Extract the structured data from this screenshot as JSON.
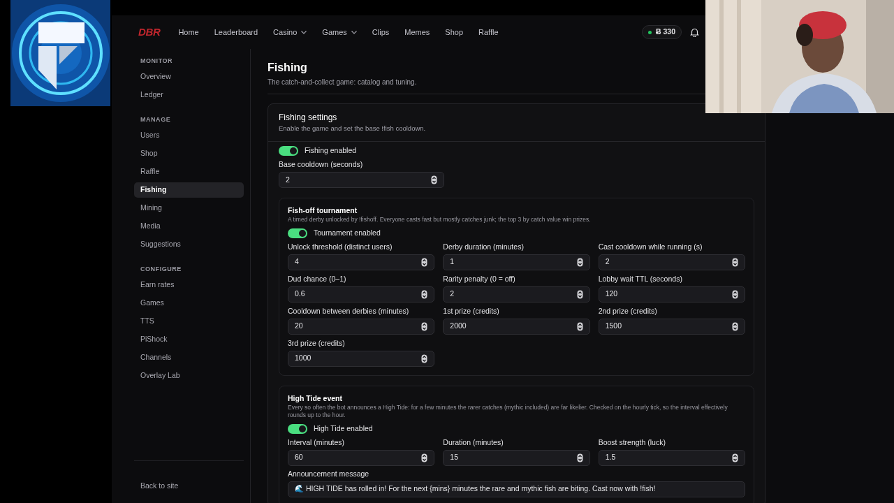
{
  "nav": {
    "logo": "DBR",
    "links": [
      {
        "label": "Home",
        "dropdown": false
      },
      {
        "label": "Leaderboard",
        "dropdown": false
      },
      {
        "label": "Casino",
        "dropdown": true
      },
      {
        "label": "Games",
        "dropdown": true
      },
      {
        "label": "Clips",
        "dropdown": false
      },
      {
        "label": "Memes",
        "dropdown": false
      },
      {
        "label": "Shop",
        "dropdown": false
      },
      {
        "label": "Raffle",
        "dropdown": false
      }
    ],
    "balance": {
      "text": "Ƀ 330",
      "color": "#22c55e"
    }
  },
  "sidebar": {
    "sections": [
      {
        "heading": "MONITOR",
        "items": [
          {
            "label": "Overview",
            "selected": false
          },
          {
            "label": "Ledger",
            "selected": false
          }
        ]
      },
      {
        "heading": "MANAGE",
        "items": [
          {
            "label": "Users",
            "selected": false
          },
          {
            "label": "Shop",
            "selected": false
          },
          {
            "label": "Raffle",
            "selected": false
          },
          {
            "label": "Fishing",
            "selected": true
          },
          {
            "label": "Mining",
            "selected": false
          },
          {
            "label": "Media",
            "selected": false
          },
          {
            "label": "Suggestions",
            "selected": false
          }
        ]
      },
      {
        "heading": "CONFIGURE",
        "items": [
          {
            "label": "Earn rates",
            "selected": false
          },
          {
            "label": "Games",
            "selected": false
          },
          {
            "label": "TTS",
            "selected": false
          },
          {
            "label": "PiShock",
            "selected": false
          },
          {
            "label": "Channels",
            "selected": false
          },
          {
            "label": "Overlay Lab",
            "selected": false
          }
        ]
      }
    ],
    "footer": "Back to site"
  },
  "page": {
    "title": "Fishing",
    "subtitle": "The catch-and-collect game: catalog and tuning."
  },
  "card": {
    "title": "Fishing settings",
    "description": "Enable the game and set the base !fish cooldown.",
    "toggle": {
      "label": "Fishing enabled",
      "on": true
    },
    "field": {
      "label": "Base cooldown (seconds)",
      "value": "2"
    },
    "subsections": [
      {
        "title": "Fish-off tournament",
        "description": "A timed derby unlocked by !fishoff. Everyone casts fast but mostly catches junk; the top 3 by catch value win prizes.",
        "toggle": {
          "label": "Tournament enabled",
          "on": true
        },
        "fields": [
          {
            "label": "Unlock threshold (distinct users)",
            "value": "4"
          },
          {
            "label": "Derby duration (minutes)",
            "value": "1"
          },
          {
            "label": "Cast cooldown while running (s)",
            "value": "2"
          },
          {
            "label": "Dud chance (0–1)",
            "value": "0.6"
          },
          {
            "label": "Rarity penalty (0 = off)",
            "value": "2"
          },
          {
            "label": "Lobby wait TTL (seconds)",
            "value": "120"
          },
          {
            "label": "Cooldown between derbies (minutes)",
            "value": "20"
          },
          {
            "label": "1st prize (credits)",
            "value": "2000"
          },
          {
            "label": "2nd prize (credits)",
            "value": "1500"
          },
          {
            "label": "3rd prize (credits)",
            "value": "1000"
          }
        ]
      },
      {
        "title": "High Tide event",
        "description": "Every so often the bot announces a High Tide: for a few minutes the rarer catches (mythic included) are far likelier. Checked on the hourly tick, so the interval effectively rounds up to the hour.",
        "toggle": {
          "label": "High Tide enabled",
          "on": true
        },
        "fields": [
          {
            "label": "Interval (minutes)",
            "value": "60"
          },
          {
            "label": "Duration (minutes)",
            "value": "15"
          },
          {
            "label": "Boost strength (luck)",
            "value": "1.5"
          }
        ],
        "message": {
          "label": "Announcement message",
          "value": "🌊 HIGH TIDE has rolled in! For the next {mins} minutes the rare and mythic fish are biting. Cast now with !fish!"
        }
      }
    ]
  }
}
